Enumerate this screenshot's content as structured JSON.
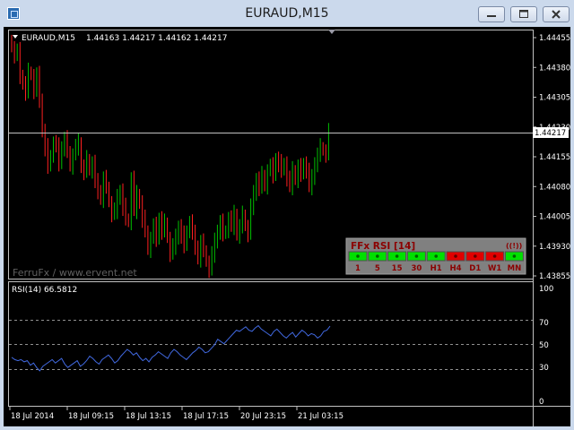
{
  "window": {
    "title": "EURAUD,M15",
    "buttons": [
      "minimize",
      "maximize",
      "close"
    ]
  },
  "symbol_info": {
    "label": "EURAUD,M15",
    "ohlc": "1.44163 1.44217 1.44162 1.44217"
  },
  "price_axis": {
    "ticks": [
      "1.44455",
      "1.44380",
      "1.44305",
      "1.44230",
      "1.44155",
      "1.44080",
      "1.44005",
      "1.43930",
      "1.43855"
    ],
    "current_price": "1.44217"
  },
  "watermark": "FerruFx / www.ervent.net",
  "ffx_panel": {
    "title": "FFx RSI [14]",
    "signal_icon": "((!))",
    "timeframes": [
      "1",
      "5",
      "15",
      "30",
      "H1",
      "H4",
      "D1",
      "W1",
      "MN"
    ],
    "states": [
      "green",
      "green",
      "green",
      "green",
      "green",
      "red",
      "red",
      "red",
      "green"
    ],
    "colors": {
      "green": "#00e000",
      "red": "#e00000",
      "panel": "#808080",
      "title": "#8b0000"
    }
  },
  "rsi": {
    "label": "RSI(14) 66.5812",
    "levels": [
      "100",
      "70",
      "50",
      "30",
      "0"
    ],
    "color": "#4169e1"
  },
  "time_axis": [
    "18 Jul 2014",
    "18 Jul 09:15",
    "18 Jul 13:15",
    "18 Jul 17:15",
    "20 Jul 23:15",
    "21 Jul 03:15"
  ],
  "chart_data": {
    "type": "candlestick",
    "symbol": "EURAUD",
    "timeframe": "M15",
    "ylim": [
      1.43855,
      1.44455
    ],
    "close": [
      1.4443,
      1.4441,
      1.4442,
      1.4436,
      1.4434,
      1.4432,
      1.4437,
      1.4436,
      1.4432,
      1.4436,
      1.443,
      1.4422,
      1.4418,
      1.4413,
      1.4416,
      1.4419,
      1.4418,
      1.4414,
      1.4418,
      1.442,
      1.4417,
      1.4413,
      1.4416,
      1.4418,
      1.4419,
      1.4413,
      1.4412,
      1.4415,
      1.4412,
      1.4414,
      1.4409,
      1.4407,
      1.4405,
      1.441,
      1.4408,
      1.4404,
      1.4401,
      1.4402,
      1.4405,
      1.4407,
      1.4403,
      1.44,
      1.4399,
      1.441,
      1.4402,
      1.4406,
      1.4404,
      1.44,
      1.4397,
      1.4392,
      1.4395,
      1.4398,
      1.4395,
      1.44,
      1.4397,
      1.4399,
      1.4395,
      1.4391,
      1.4393,
      1.4395,
      1.4398,
      1.4396,
      1.4393,
      1.4397,
      1.4399,
      1.4396,
      1.4393,
      1.439,
      1.4394,
      1.4392,
      1.4389,
      1.4387,
      1.4391,
      1.4394,
      1.4397,
      1.4399,
      1.4396,
      1.4397,
      1.44,
      1.4398,
      1.4401,
      1.4396,
      1.4398,
      1.4401,
      1.4398,
      1.4396,
      1.4403,
      1.4406,
      1.441,
      1.4408,
      1.4411,
      1.4408,
      1.4412,
      1.4413,
      1.4411,
      1.4415,
      1.4414,
      1.4412,
      1.4414,
      1.441,
      1.4408,
      1.4412,
      1.441,
      1.4413,
      1.4411,
      1.4414,
      1.4412,
      1.4408,
      1.441,
      1.4414,
      1.4416,
      1.4418,
      1.4417,
      1.4416,
      1.4422
    ],
    "rsi": [
      39,
      37,
      36,
      37,
      35,
      36,
      32,
      34,
      30,
      27,
      31,
      33,
      35,
      37,
      34,
      36,
      38,
      33,
      30,
      32,
      34,
      36,
      31,
      33,
      36,
      40,
      38,
      35,
      33,
      37,
      39,
      41,
      38,
      34,
      36,
      40,
      43,
      46,
      44,
      41,
      43,
      39,
      36,
      38,
      35,
      39,
      41,
      44,
      42,
      40,
      38,
      43,
      46,
      44,
      41,
      39,
      37,
      40,
      43,
      45,
      48,
      46,
      43,
      44,
      47,
      50,
      55,
      53,
      51,
      54,
      57,
      60,
      63,
      62,
      64,
      66,
      63,
      62,
      65,
      67,
      64,
      62,
      60,
      58,
      62,
      64,
      61,
      58,
      56,
      59,
      61,
      57,
      60,
      63,
      61,
      58,
      60,
      59,
      56,
      58,
      62,
      63,
      66.58
    ]
  }
}
